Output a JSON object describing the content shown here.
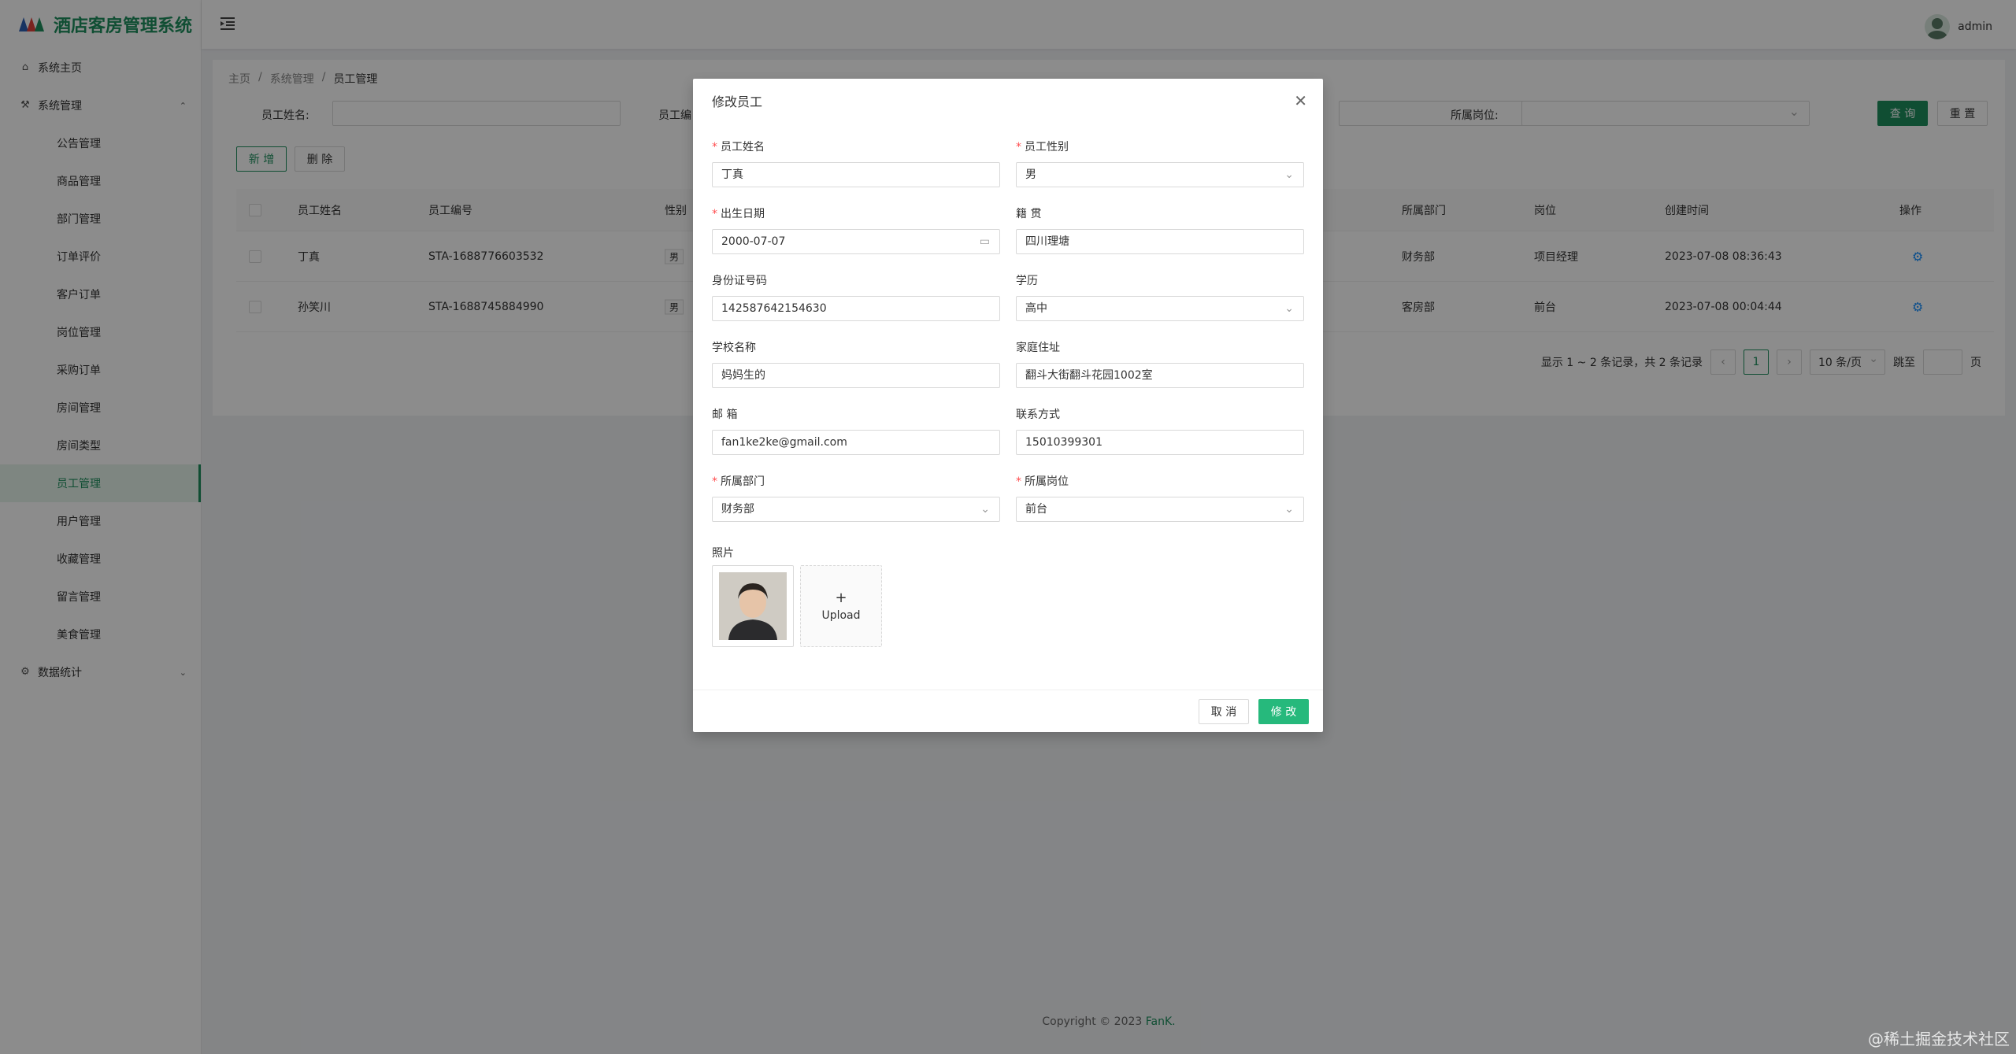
{
  "app": {
    "title": "酒店客房管理系统"
  },
  "header": {
    "user_name": "admin"
  },
  "sidebar": {
    "home": "系统主页",
    "system": "系统管理",
    "items": [
      "公告管理",
      "商品管理",
      "部门管理",
      "订单评价",
      "客户订单",
      "岗位管理",
      "采购订单",
      "房间管理",
      "房间类型",
      "员工管理",
      "用户管理",
      "收藏管理",
      "留言管理",
      "美食管理"
    ],
    "active_index": 9,
    "stats": "数据统计"
  },
  "breadcrumb": [
    "主页",
    "系统管理",
    "员工管理"
  ],
  "search": {
    "name_label": "员工姓名:",
    "code_label": "员工编",
    "post_label": "所属岗位:",
    "query_btn": "查 询",
    "reset_btn": "重 置"
  },
  "toolbar": {
    "add": "新 增",
    "delete": "删 除"
  },
  "table": {
    "headers": {
      "name": "员工姓名",
      "code": "员工编号",
      "gender": "性别",
      "dept": "所属部门",
      "post": "岗位",
      "created": "创建时间",
      "op": "操作"
    },
    "rows": [
      {
        "name": "丁真",
        "code": "STA-1688776603532",
        "gender": "男",
        "dept": "财务部",
        "post": "项目经理",
        "created": "2023-07-08 08:36:43"
      },
      {
        "name": "孙笑川",
        "code": "STA-1688745884990",
        "gender": "男",
        "dept": "客房部",
        "post": "前台",
        "created": "2023-07-08 00:04:44"
      }
    ]
  },
  "pager": {
    "summary": "显示 1 ~ 2 条记录，共 2 条记录",
    "current": "1",
    "size": "10 条/页",
    "jump": "跳至",
    "page": "页"
  },
  "footer": {
    "copy": "Copyright © 2023 ",
    "brand": "FanK."
  },
  "watermark": "@稀土掘金技术社区",
  "modal": {
    "title": "修改员工",
    "fields": {
      "name": {
        "label": "员工姓名",
        "value": "丁真"
      },
      "gender": {
        "label": "员工性别",
        "value": "男"
      },
      "birth": {
        "label": "出生日期",
        "value": "2000-07-07"
      },
      "native": {
        "label": "籍 贯",
        "value": "四川理塘"
      },
      "idcard": {
        "label": "身份证号码",
        "value": "142587642154630"
      },
      "edu": {
        "label": "学历",
        "value": "高中"
      },
      "school": {
        "label": "学校名称",
        "value": "妈妈生的"
      },
      "address": {
        "label": "家庭住址",
        "value": "翻斗大街翻斗花园1002室"
      },
      "email": {
        "label": "邮 箱",
        "value": "fan1ke2ke@gmail.com"
      },
      "phone": {
        "label": "联系方式",
        "value": "15010399301"
      },
      "dept": {
        "label": "所属部门",
        "value": "财务部"
      },
      "post": {
        "label": "所属岗位",
        "value": "前台"
      }
    },
    "photo_label": "照片",
    "upload_plus": "+",
    "upload_text": "Upload",
    "cancel": "取 消",
    "submit": "修 改"
  },
  "colors": {
    "primary": "#1e8f5e",
    "link": "#1890ff",
    "required": "#ff4d4f"
  }
}
